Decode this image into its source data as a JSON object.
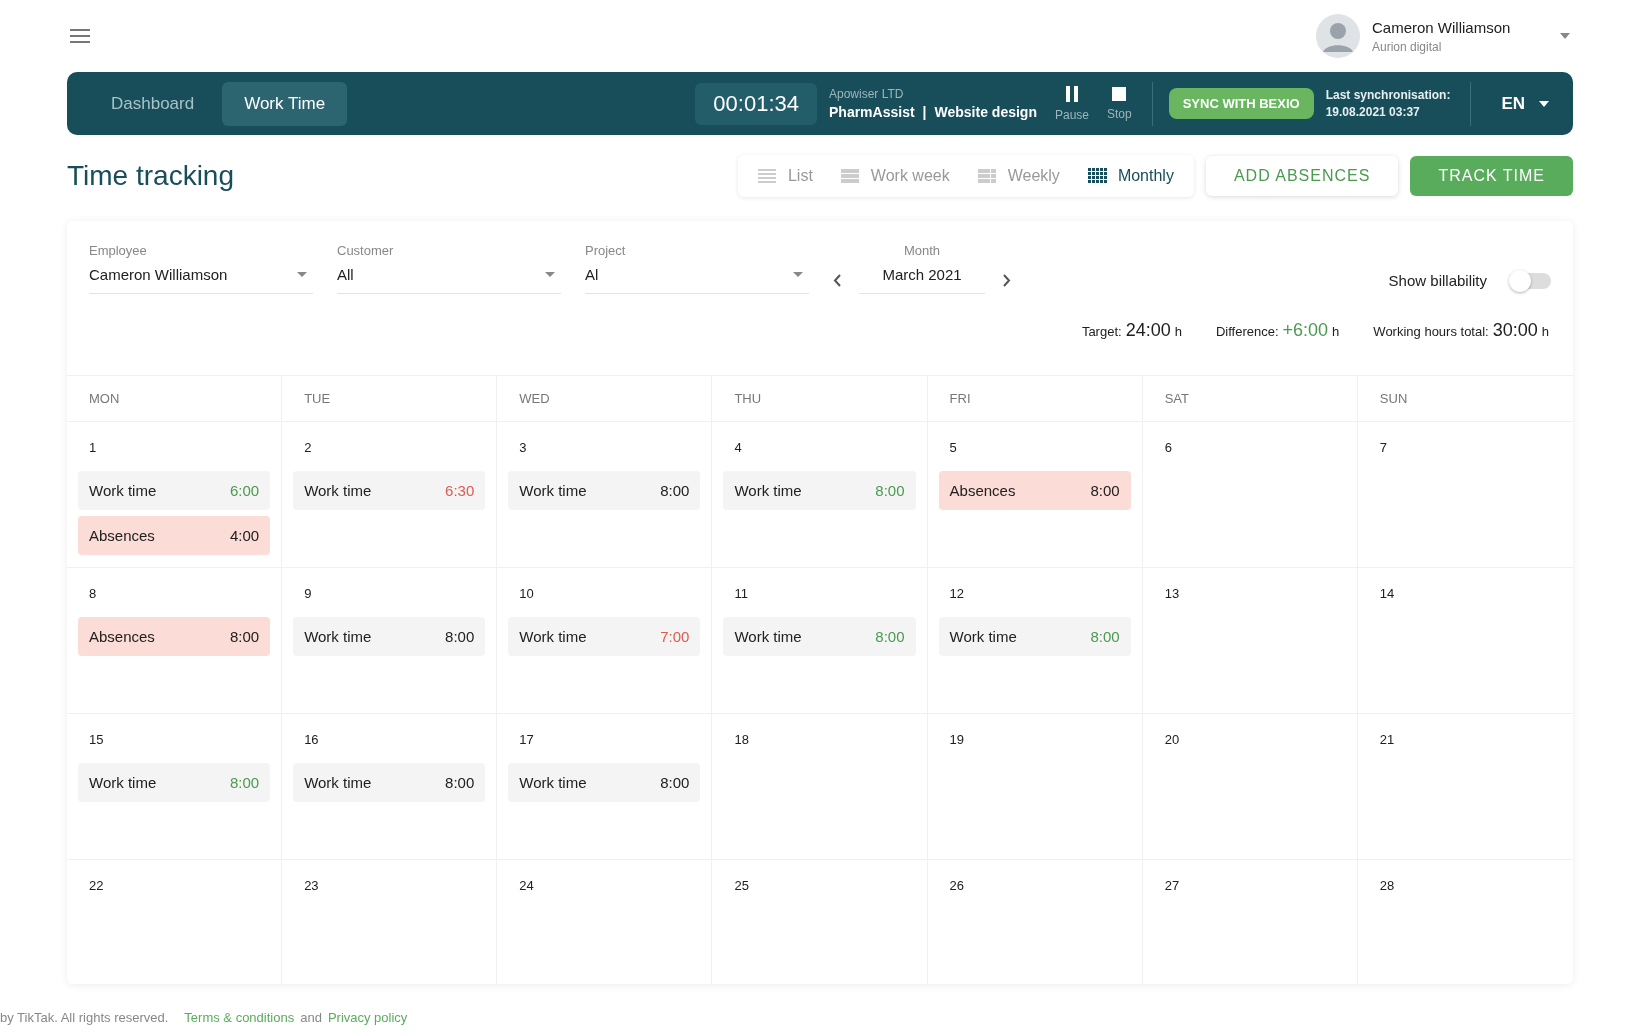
{
  "user": {
    "name": "Cameron Williamson",
    "company": "Aurion digital"
  },
  "nav": {
    "tabs": [
      {
        "label": "Dashboard",
        "selected": false
      },
      {
        "label": "Work Time",
        "selected": true
      }
    ],
    "timer": "00:01:34",
    "company": "Apowiser LTD",
    "project": "PharmAssist",
    "separator": "|",
    "task": "Website design",
    "controls": [
      {
        "kind": "pause",
        "label": "Pause"
      },
      {
        "kind": "stop",
        "label": "Stop"
      }
    ],
    "sync_button": "SYNC WITH BEXIO",
    "sync_label": "Last synchronisation:",
    "sync_time": "19.08.2021 03:37",
    "language": "EN"
  },
  "page_title": "Time tracking",
  "views": [
    {
      "kind": "list",
      "label": "List",
      "selected": false
    },
    {
      "kind": "workweek",
      "label": "Work week",
      "selected": false
    },
    {
      "kind": "weekly",
      "label": "Weekly",
      "selected": false
    },
    {
      "kind": "monthly",
      "label": "Monthly",
      "selected": true
    }
  ],
  "add_absences": "ADD ABSENCES",
  "track_time": "TRACK TIME",
  "filters": [
    {
      "label": "Employee",
      "value": "Cameron Williamson"
    },
    {
      "label": "Customer",
      "value": "All"
    },
    {
      "label": "Project",
      "value": "Al"
    }
  ],
  "month": {
    "label": "Month",
    "value": "March 2021"
  },
  "billability": {
    "label": "Show billability",
    "on": false
  },
  "totals": [
    {
      "label": "Target:",
      "value": "24:00",
      "unit": "h",
      "color": "#212121"
    },
    {
      "label": "Difference:",
      "value": "+6:00",
      "unit": "h",
      "color": "#4a9a4f"
    },
    {
      "label": "Working hours total:",
      "value": "30:00",
      "unit": "h",
      "color": "#212121"
    }
  ],
  "weekdays": [
    "MON",
    "TUE",
    "WED",
    "THU",
    "FRI",
    "SAT",
    "SUN"
  ],
  "weeks": [
    [
      {
        "day": "1",
        "entries": [
          {
            "kind": "work",
            "label": "Work time",
            "time": "6:00",
            "color": "#4a9a4f"
          },
          {
            "kind": "absence",
            "label": "Absences",
            "time": "4:00",
            "color": "#212121"
          }
        ]
      },
      {
        "day": "2",
        "entries": [
          {
            "kind": "work",
            "label": "Work time",
            "time": "6:30",
            "color": "#e05a4e"
          }
        ]
      },
      {
        "day": "3",
        "entries": [
          {
            "kind": "work",
            "label": "Work time",
            "time": "8:00",
            "color": "#212121"
          }
        ]
      },
      {
        "day": "4",
        "entries": [
          {
            "kind": "work",
            "label": "Work time",
            "time": "8:00",
            "color": "#4a9a4f"
          }
        ]
      },
      {
        "day": "5",
        "entries": [
          {
            "kind": "absence",
            "label": "Absences",
            "time": "8:00",
            "color": "#212121"
          }
        ]
      },
      {
        "day": "6"
      },
      {
        "day": "7"
      }
    ],
    [
      {
        "day": "8",
        "entries": [
          {
            "kind": "absence",
            "label": "Absences",
            "time": "8:00",
            "color": "#212121"
          }
        ]
      },
      {
        "day": "9",
        "entries": [
          {
            "kind": "work",
            "label": "Work time",
            "time": "8:00",
            "color": "#212121"
          }
        ]
      },
      {
        "day": "10",
        "entries": [
          {
            "kind": "work",
            "label": "Work time",
            "time": "7:00",
            "color": "#e05a4e"
          }
        ]
      },
      {
        "day": "11",
        "entries": [
          {
            "kind": "work",
            "label": "Work time",
            "time": "8:00",
            "color": "#4a9a4f"
          }
        ]
      },
      {
        "day": "12",
        "entries": [
          {
            "kind": "work",
            "label": "Work time",
            "time": "8:00",
            "color": "#4a9a4f"
          }
        ]
      },
      {
        "day": "13"
      },
      {
        "day": "14"
      }
    ],
    [
      {
        "day": "15",
        "entries": [
          {
            "kind": "work",
            "label": "Work time",
            "time": "8:00",
            "color": "#4a9a4f"
          }
        ]
      },
      {
        "day": "16",
        "entries": [
          {
            "kind": "work",
            "label": "Work time",
            "time": "8:00",
            "color": "#212121"
          }
        ]
      },
      {
        "day": "17",
        "entries": [
          {
            "kind": "work",
            "label": "Work time",
            "time": "8:00",
            "color": "#212121"
          }
        ]
      },
      {
        "day": "18"
      },
      {
        "day": "19"
      },
      {
        "day": "20"
      },
      {
        "day": "21"
      }
    ],
    [
      {
        "day": "22"
      },
      {
        "day": "23"
      },
      {
        "day": "24"
      },
      {
        "day": "25"
      },
      {
        "day": "26"
      },
      {
        "day": "27"
      },
      {
        "day": "28"
      }
    ]
  ],
  "footer": {
    "text": "by TikTak. All rights reserved.",
    "terms": "Terms & conditions",
    "and": "and",
    "privacy": "Privacy policy"
  }
}
